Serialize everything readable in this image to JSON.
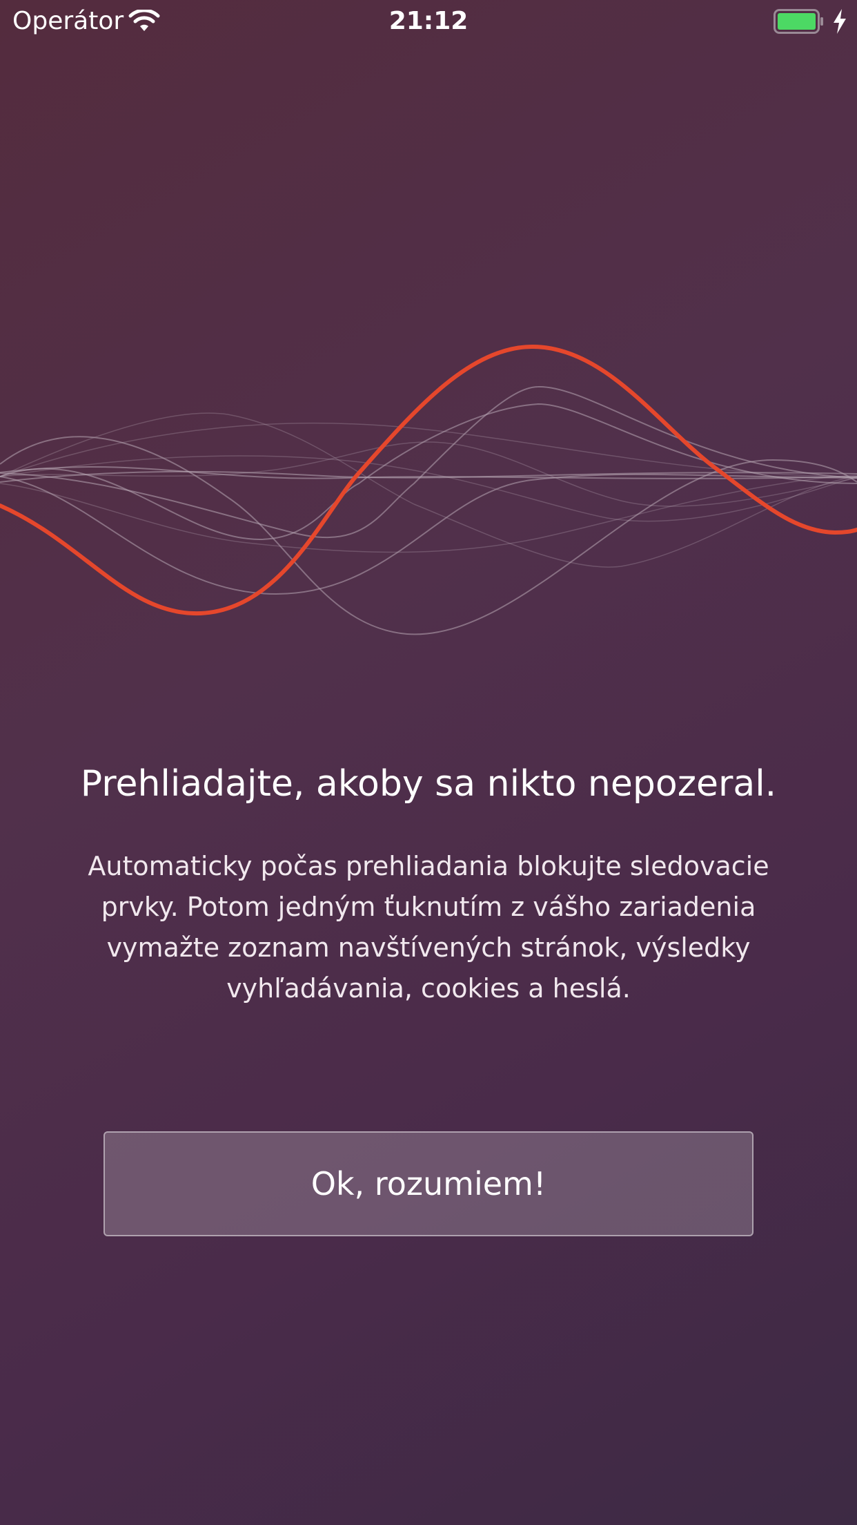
{
  "status_bar": {
    "carrier": "Operátor",
    "time": "21:12",
    "wifi_icon": "wifi-icon",
    "battery_icon": "battery-icon",
    "charging_icon": "charging-bolt-icon",
    "battery_color": "#4cd964"
  },
  "illustration": {
    "name": "sound-wave-illustration",
    "accent_color": "#e5472c",
    "line_color": "#b7a5b2"
  },
  "onboarding": {
    "headline": "Prehliadajte, akoby sa nikto nepozeral.",
    "body": "Automaticky počas prehliadania blokujte sledovacie prvky. Potom jedným ťuknutím z vášho zariadenia vymažte zoznam navštívených stránok, výsledky vyhľadávania, cookies a heslá.",
    "ok_button": "Ok, rozumiem!"
  }
}
